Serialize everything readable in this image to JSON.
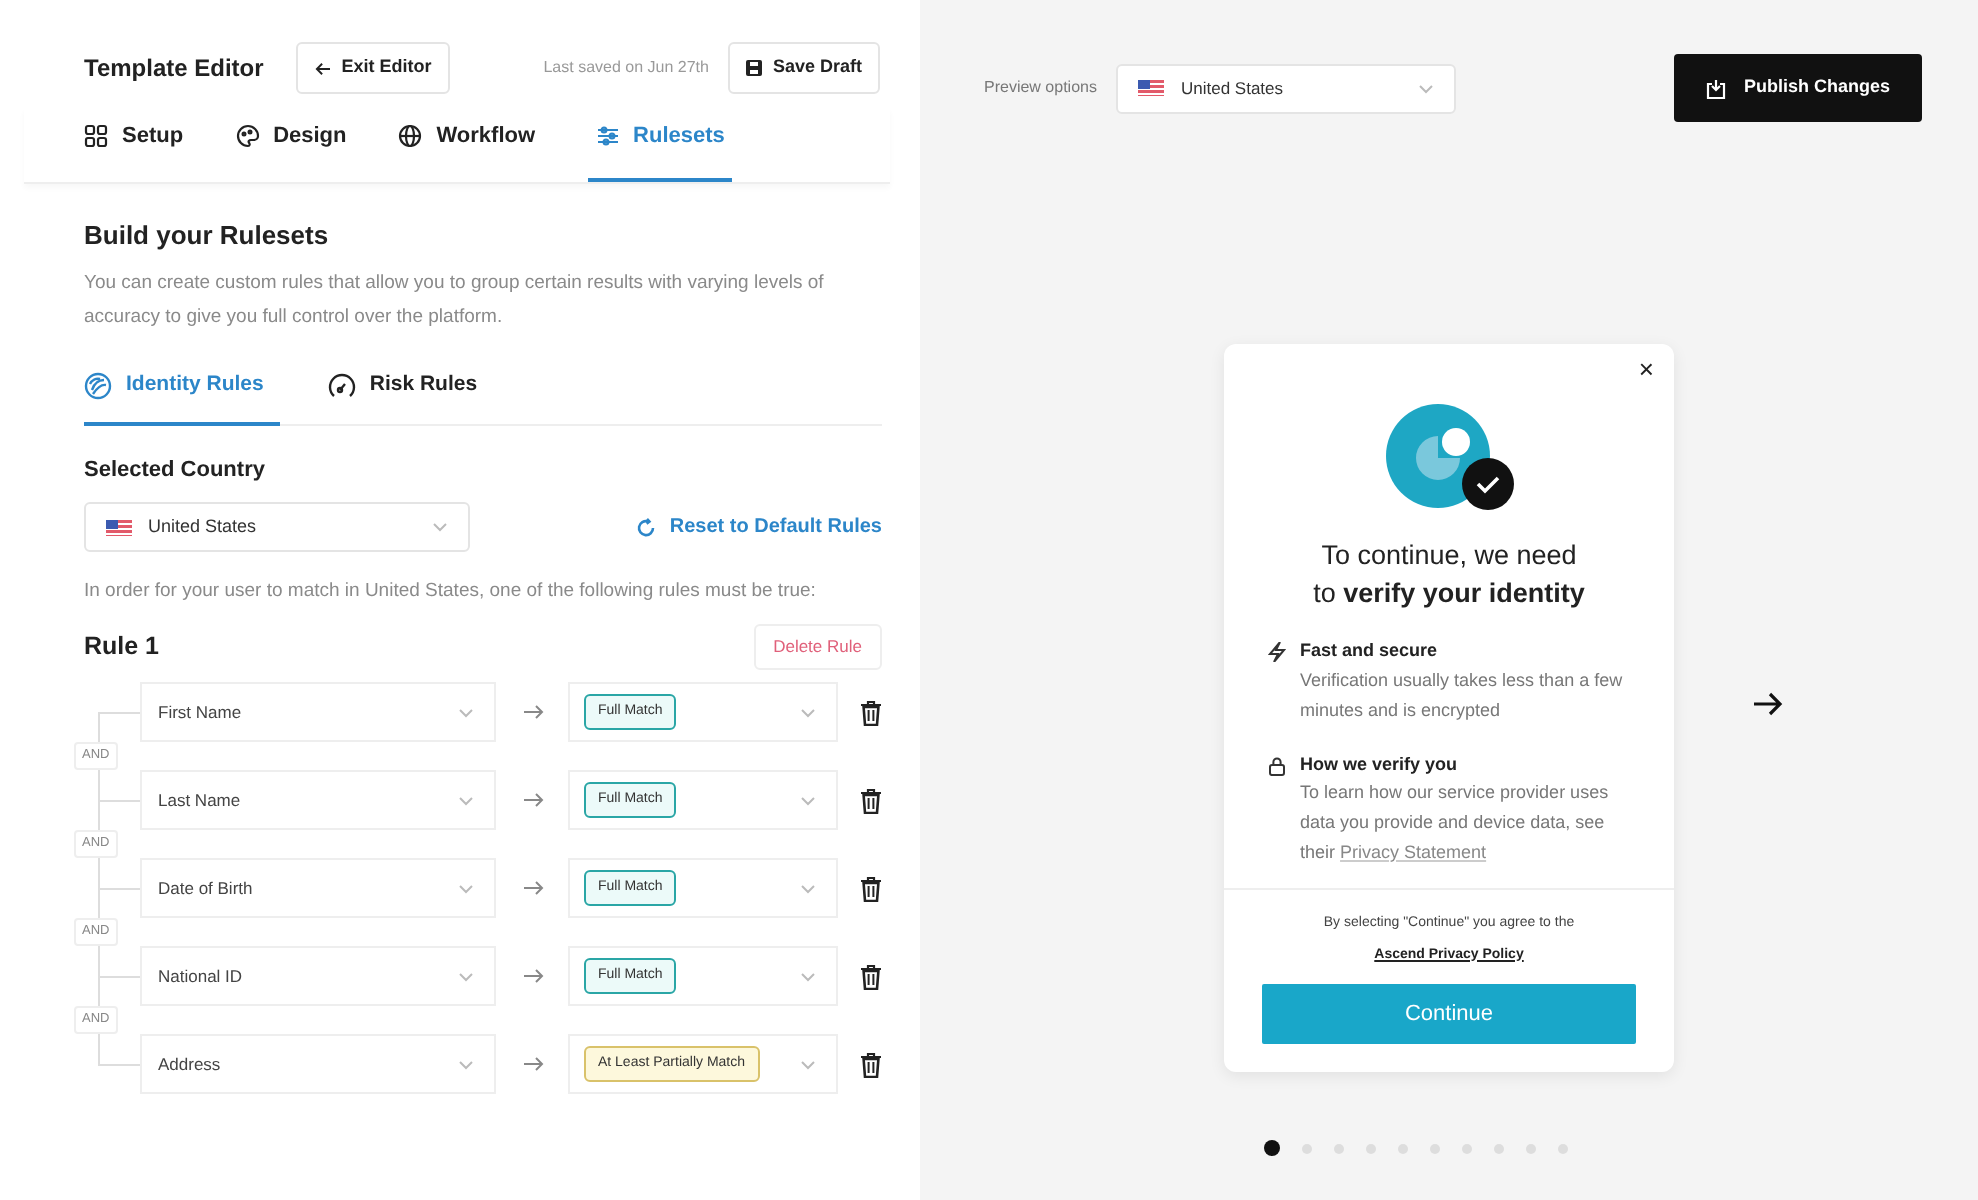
{
  "header": {
    "title": "Template Editor",
    "exit_button": "Exit Editor",
    "last_saved": "Last saved on Jun 27th",
    "save_button": "Save Draft"
  },
  "tabs": [
    {
      "label": "Setup",
      "selected": false
    },
    {
      "label": "Design",
      "selected": false
    },
    {
      "label": "Workflow",
      "selected": false
    },
    {
      "label": "Rulesets",
      "selected": true
    }
  ],
  "rulesets": {
    "heading": "Build your Rulesets",
    "description": "You can create custom rules that allow you to group certain results with varying levels of accuracy to give you full control over the platform.",
    "subtabs": [
      {
        "label": "Identity Rules",
        "selected": true
      },
      {
        "label": "Risk Rules",
        "selected": false
      }
    ],
    "country_label": "Selected Country",
    "country": "United States",
    "reset_link": "Reset to Default Rules",
    "instruction": "In order for your user to match in United States, one of the following rules must be true:",
    "rule": {
      "title": "Rule 1",
      "delete_button": "Delete Rule",
      "conditions": [
        {
          "field": "First Name",
          "match": "Full Match",
          "kind": "full"
        },
        {
          "join": "AND",
          "field": "Last Name",
          "match": "Full Match",
          "kind": "full"
        },
        {
          "join": "AND",
          "field": "Date of Birth",
          "match": "Full Match",
          "kind": "full"
        },
        {
          "join": "AND",
          "field": "National ID",
          "match": "Full Match",
          "kind": "full"
        },
        {
          "join": "AND",
          "field": "Address",
          "match": "At Least Partially Match",
          "kind": "partial"
        }
      ]
    }
  },
  "preview": {
    "label": "Preview options",
    "country": "United States",
    "publish_button": "Publish Changes",
    "modal": {
      "close": "×",
      "heading": "To continue, we need\nto **verify your identity**",
      "features": [
        {
          "title": "Fast and secure",
          "text": "Verification usually takes less than a few minutes and is encrypted"
        },
        {
          "title": "How we verify you",
          "text": "To learn how our service provider uses data you provide and device data, see their",
          "link": "Privacy Statement"
        }
      ],
      "consent": "By selecting \"Continue\" you agree to the",
      "policy_link": "Ascend Privacy Policy",
      "continue_button": "Continue"
    },
    "pages": [
      {
        "selected": true
      },
      {
        "selected": false
      },
      {
        "selected": false
      },
      {
        "selected": false
      },
      {
        "selected": false
      },
      {
        "selected": false
      },
      {
        "selected": false
      },
      {
        "selected": false
      },
      {
        "selected": false
      },
      {
        "selected": false
      }
    ]
  }
}
